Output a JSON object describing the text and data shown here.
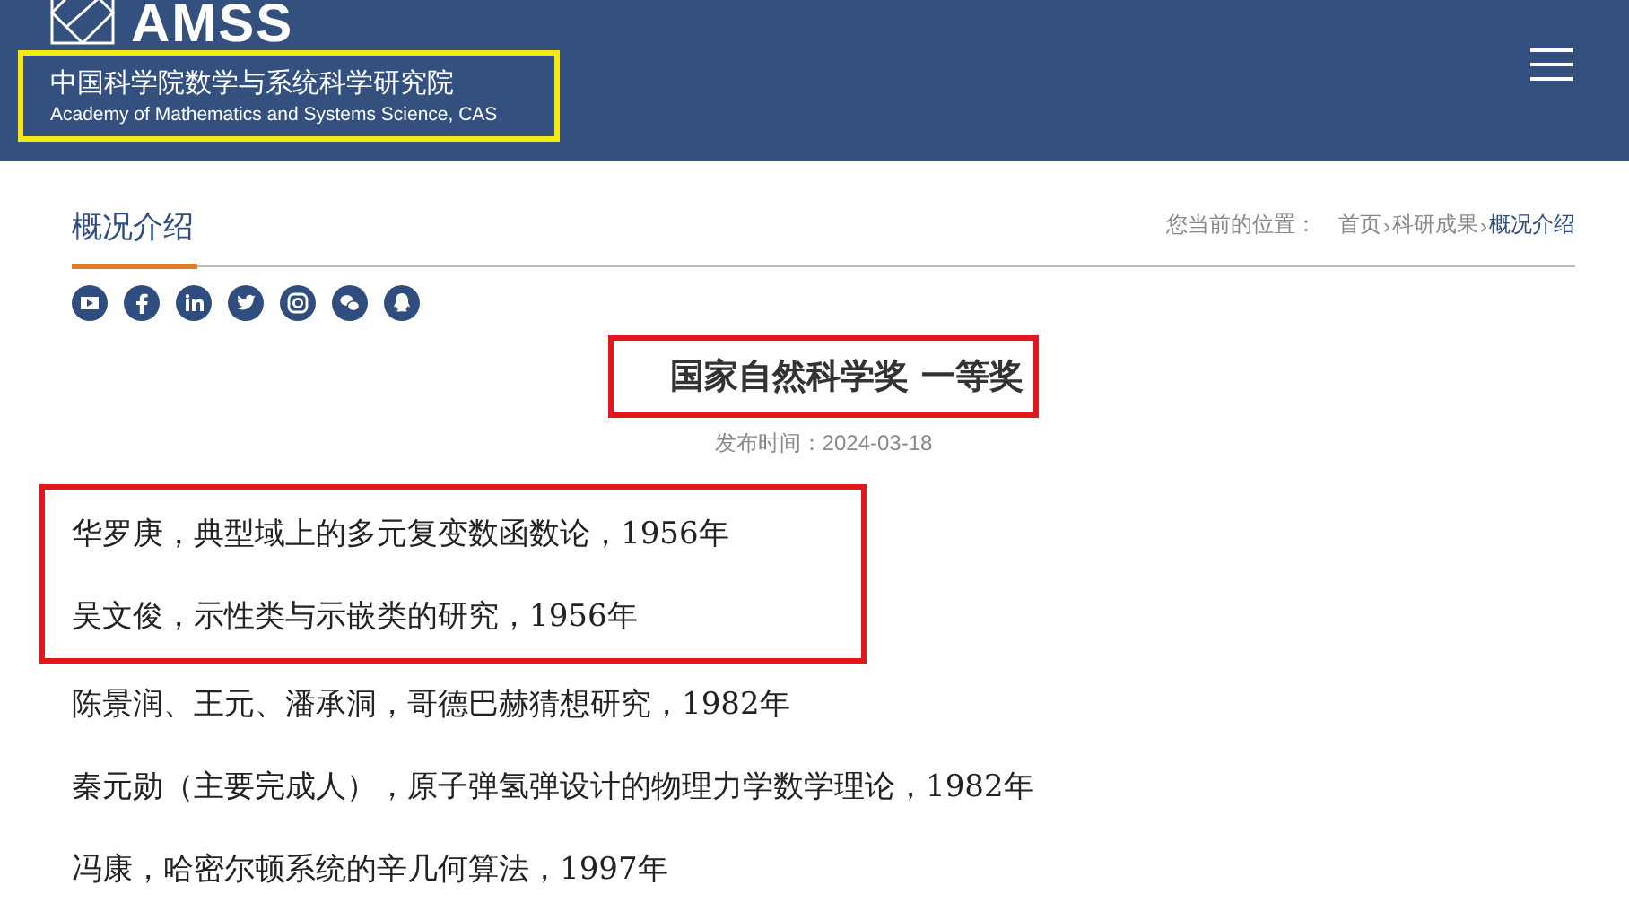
{
  "header": {
    "logo_text": "AMSS",
    "name_zh": "中国科学院数学与系统科学研究院",
    "name_en": "Academy of Mathematics and Systems Science, CAS",
    "name_highlighted": true
  },
  "section": {
    "title": "概况介绍",
    "breadcrumb_label": "您当前的位置：",
    "separator": "›",
    "breadcrumb": [
      {
        "label": "首页",
        "current": false
      },
      {
        "label": "科研成果",
        "current": false
      },
      {
        "label": "概况介绍",
        "current": true
      }
    ]
  },
  "article": {
    "title": "国家自然科学奖 一等奖",
    "title_highlighted": true,
    "date": "发布时间：2024-03-18",
    "entries": [
      {
        "text": "华罗庚，典型域上的多元复变数函数论，1956年",
        "highlighted": true
      },
      {
        "text": "吴文俊，示性类与示嵌类的研究，1956年",
        "highlighted": true
      },
      {
        "text": "陈景润、王元、潘承洞，哥德巴赫猜想研究，1982年",
        "highlighted": false
      },
      {
        "text": "秦元勋（主要完成人），原子弹氢弹设计的物理力学数学理论，1982年",
        "highlighted": false
      },
      {
        "text": "冯康，哈密尔顿系统的辛几何算法，1997年",
        "highlighted": false
      }
    ]
  }
}
